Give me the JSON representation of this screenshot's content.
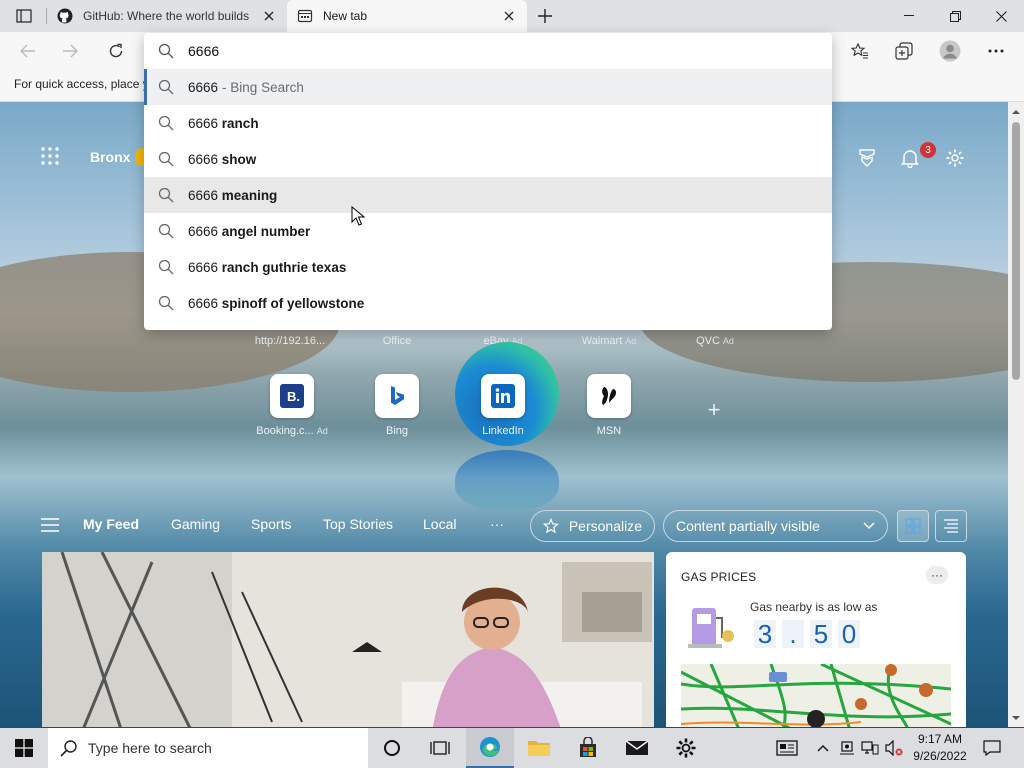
{
  "browser": {
    "tabs": [
      {
        "title": "GitHub: Where the world builds",
        "favicon": "github-icon",
        "active": false
      },
      {
        "title": "New tab",
        "favicon": "new-tab-icon",
        "active": true
      }
    ]
  },
  "toolbar": {
    "address_value": "6666"
  },
  "favorites_bar": {
    "hint": "For quick access, place y"
  },
  "omnibox": {
    "suggestions": [
      {
        "prefix": "6666",
        "bold": "",
        "suffix": " - Bing Search",
        "highlighted": false,
        "selected": true
      },
      {
        "prefix": "6666 ",
        "bold": "ranch",
        "suffix": ""
      },
      {
        "prefix": "6666 ",
        "bold": "show",
        "suffix": ""
      },
      {
        "prefix": "6666 ",
        "bold": "meaning",
        "suffix": "",
        "highlighted": true
      },
      {
        "prefix": "6666 ",
        "bold": "angel number",
        "suffix": ""
      },
      {
        "prefix": "6666 ",
        "bold": "ranch guthrie texas",
        "suffix": ""
      },
      {
        "prefix": "6666 ",
        "bold": "spinoff of yellowstone",
        "suffix": ""
      }
    ]
  },
  "ntp": {
    "location": "Bronx",
    "notifications_count": "3",
    "quick_links_top": [
      {
        "label": "http://192.16...",
        "ad": ""
      },
      {
        "label": "Office",
        "ad": ""
      },
      {
        "label": "eBay",
        "ad": "Ad"
      },
      {
        "label": "Walmart",
        "ad": "Ad"
      },
      {
        "label": "QVC",
        "ad": "Ad"
      }
    ],
    "quick_links": [
      {
        "label": "Booking.c...",
        "ad": "Ad",
        "icon": "booking-icon"
      },
      {
        "label": "Bing",
        "ad": "",
        "icon": "bing-icon"
      },
      {
        "label": "LinkedIn",
        "ad": "",
        "icon": "linkedin-icon"
      },
      {
        "label": "MSN",
        "ad": "",
        "icon": "msn-icon"
      }
    ],
    "feed_tabs": [
      "My Feed",
      "Gaming",
      "Sports",
      "Top Stories",
      "Local"
    ],
    "more_label": "···",
    "personalize_label": "Personalize",
    "content_visibility": "Content partially visible"
  },
  "gas_card": {
    "title": "GAS PRICES",
    "subtitle": "Gas nearby is as low as",
    "price_digits": [
      "3",
      ".",
      "5",
      "0"
    ],
    "more": "···"
  },
  "taskbar": {
    "search_placeholder": "Type here to search",
    "time": "9:17 AM",
    "date": "9/26/2022"
  },
  "colors": {
    "accent": "#3a6ea5",
    "badge": "#d13438",
    "price_blue": "#1a5fb4"
  }
}
